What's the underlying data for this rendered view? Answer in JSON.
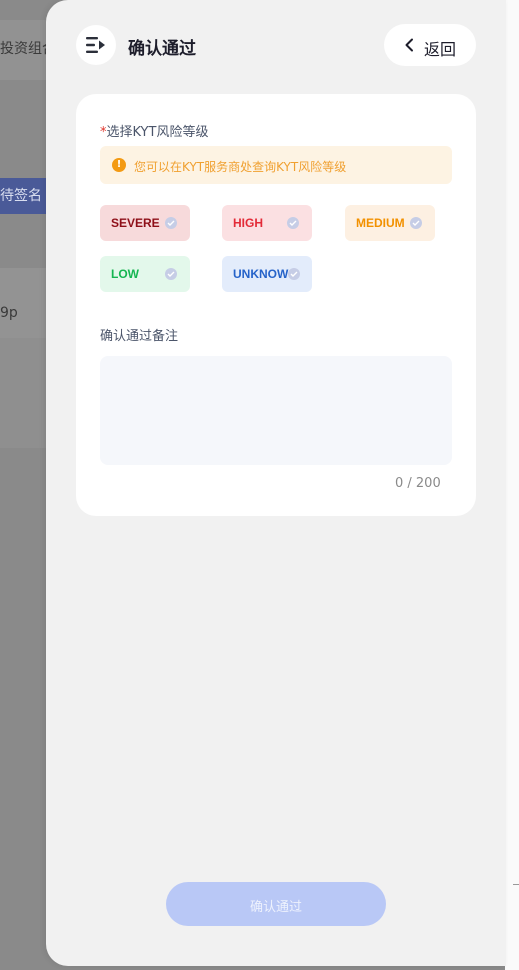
{
  "background": {
    "row1_text": "投资组合",
    "row2_text": "待签名",
    "row3_text": "9p"
  },
  "drawer": {
    "header": {
      "icon": "menu-collapse-icon",
      "title": "确认通过",
      "back_icon": "chevron-left-icon",
      "back_label": "返回"
    },
    "form": {
      "required_mark": "*",
      "risk_label": "选择KYT风险等级",
      "notice_icon": "warning-circle-icon",
      "notice_text": "您可以在KYT服务商处查询KYT风险等级",
      "risk_levels": [
        {
          "label": "SEVERE",
          "color": "#8e0f18",
          "bg": "#f7dadb"
        },
        {
          "label": "HIGH",
          "color": "#e32b38",
          "bg": "#fbe0e2"
        },
        {
          "label": "MEDIUM",
          "color": "#f29100",
          "bg": "#fdf0e2"
        },
        {
          "label": "LOW",
          "color": "#15b651",
          "bg": "#e3f8eb"
        },
        {
          "label": "UNKNOW",
          "color": "#2663c9",
          "bg": "#e3ecfb"
        }
      ],
      "remark_label": "确认通过备注",
      "remark_value": "",
      "remark_counter": "0 / 200"
    },
    "submit_label": "确认通过"
  },
  "colors": {
    "accent_disabled": "#b9c8f6",
    "required": "#e0352b",
    "warning": "#f39a13"
  }
}
